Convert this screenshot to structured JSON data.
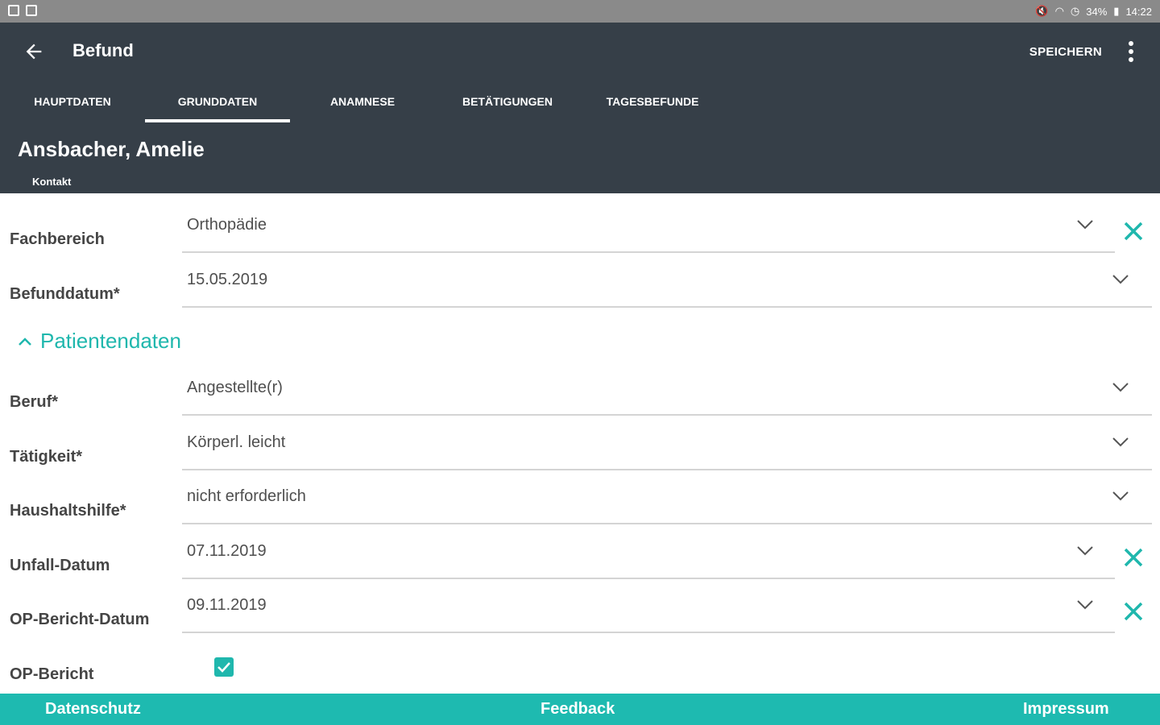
{
  "status_bar": {
    "battery": "34%",
    "time": "14:22"
  },
  "toolbar": {
    "title": "Befund",
    "save_label": "SPEICHERN"
  },
  "tabs": [
    {
      "label": "HAUPTDATEN"
    },
    {
      "label": "GRUNDDATEN"
    },
    {
      "label": "ANAMNESE"
    },
    {
      "label": "BETÄTIGUNGEN"
    },
    {
      "label": "TAGESBEFUNDE"
    }
  ],
  "active_tab": "GRUNDDATEN",
  "patient": {
    "name": "Ansbacher, Amelie",
    "contact_label": "Kontakt"
  },
  "form": {
    "fachbereich": {
      "label": "Fachbereich",
      "value": "Orthopädie"
    },
    "befunddatum": {
      "label": "Befunddatum*",
      "value": "15.05.2019"
    },
    "section_title": "Patientendaten",
    "beruf": {
      "label": "Beruf*",
      "value": "Angestellte(r)"
    },
    "taetigkeit": {
      "label": "Tätigkeit*",
      "value": "Körperl. leicht"
    },
    "haushaltshilfe": {
      "label": "Haushaltshilfe*",
      "value": "nicht erforderlich"
    },
    "unfall_datum": {
      "label": "Unfall-Datum",
      "value": "07.11.2019"
    },
    "op_bericht_datum": {
      "label": "OP-Bericht-Datum",
      "value": "09.11.2019"
    },
    "op_bericht": {
      "label": "OP-Bericht",
      "checked": true
    }
  },
  "footer": {
    "datenschutz": "Datenschutz",
    "feedback": "Feedback",
    "impressum": "Impressum"
  },
  "colors": {
    "toolbar": "#363f48",
    "accent": "#1fb7ad",
    "footer": "#1ebab0"
  }
}
